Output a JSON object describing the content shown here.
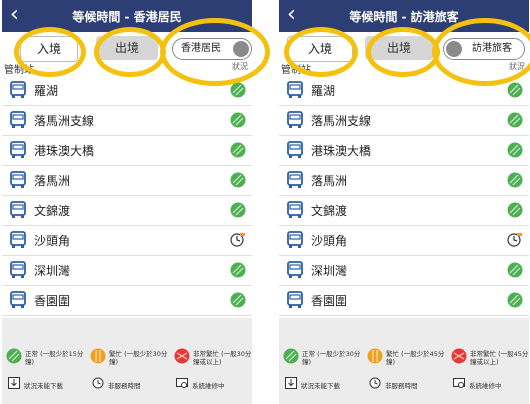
{
  "left": {
    "title": "等候時間 - 香港居民",
    "tab_in": "入境",
    "tab_out": "出境",
    "toggle": "香港居民",
    "col_station": "管制站",
    "col_status": "狀況",
    "stations": [
      {
        "name": "羅湖",
        "status": "normal"
      },
      {
        "name": "落馬洲支線",
        "status": "normal"
      },
      {
        "name": "港珠澳大橋",
        "status": "normal"
      },
      {
        "name": "落馬洲",
        "status": "normal"
      },
      {
        "name": "文錦渡",
        "status": "normal"
      },
      {
        "name": "沙頭角",
        "status": "non-service"
      },
      {
        "name": "深圳灣",
        "status": "normal"
      },
      {
        "name": "香園圍",
        "status": "normal"
      }
    ],
    "legend": {
      "normal": "正常 (一般少於15分鐘)",
      "busy": "繁忙 (一般少於30分鐘)",
      "very_busy": "非常繁忙 (一般30分鐘或以上)"
    },
    "footer": {
      "download": "狀況未能下載",
      "non_service": "非服務時間",
      "maintenance": "系統維修中"
    }
  },
  "right": {
    "title": "等候時間 - 訪港旅客",
    "tab_in": "入境",
    "tab_out": "出境",
    "toggle": "訪港旅客",
    "col_station": "管制站",
    "col_status": "狀況",
    "stations": [
      {
        "name": "羅湖",
        "status": "normal"
      },
      {
        "name": "落馬洲支線",
        "status": "normal"
      },
      {
        "name": "港珠澳大橋",
        "status": "normal"
      },
      {
        "name": "落馬洲",
        "status": "normal"
      },
      {
        "name": "文錦渡",
        "status": "normal"
      },
      {
        "name": "沙頭角",
        "status": "non-service"
      },
      {
        "name": "深圳灣",
        "status": "normal"
      },
      {
        "name": "香園圍",
        "status": "normal"
      }
    ],
    "legend": {
      "normal": "正常 (一般少於30分鐘)",
      "busy": "繁忙 (一般少於45分鐘)",
      "very_busy": "非常繁忙 (一般45分鐘或以上)"
    },
    "footer": {
      "download": "狀況未能下載",
      "non_service": "非服務時間",
      "maintenance": "系統維修中"
    }
  },
  "colors": {
    "header": "#2c3e73",
    "normal": "#4caf50",
    "busy": "#f0a020",
    "very_busy": "#e53935",
    "bus_icon": "#2c5fa8",
    "highlight_ring": "#f4c10f"
  }
}
